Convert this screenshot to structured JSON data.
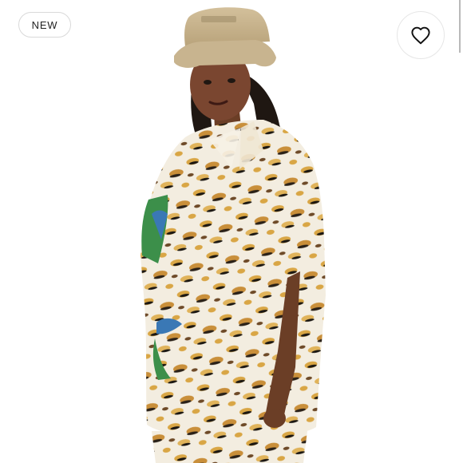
{
  "badge": {
    "label": "NEW"
  },
  "colors": {
    "background": "#ffffff",
    "hat": "#c8b48f",
    "skin": "#6b3e26",
    "hair": "#1f1712",
    "print_base": "#f3ede0",
    "print_gold": "#d9a645",
    "print_brown": "#6e4a28",
    "print_black": "#1b1712",
    "tropical_green": "#3c8f4a",
    "tropical_blue": "#3a78b5"
  },
  "icons": {
    "favorite": "heart-icon"
  }
}
